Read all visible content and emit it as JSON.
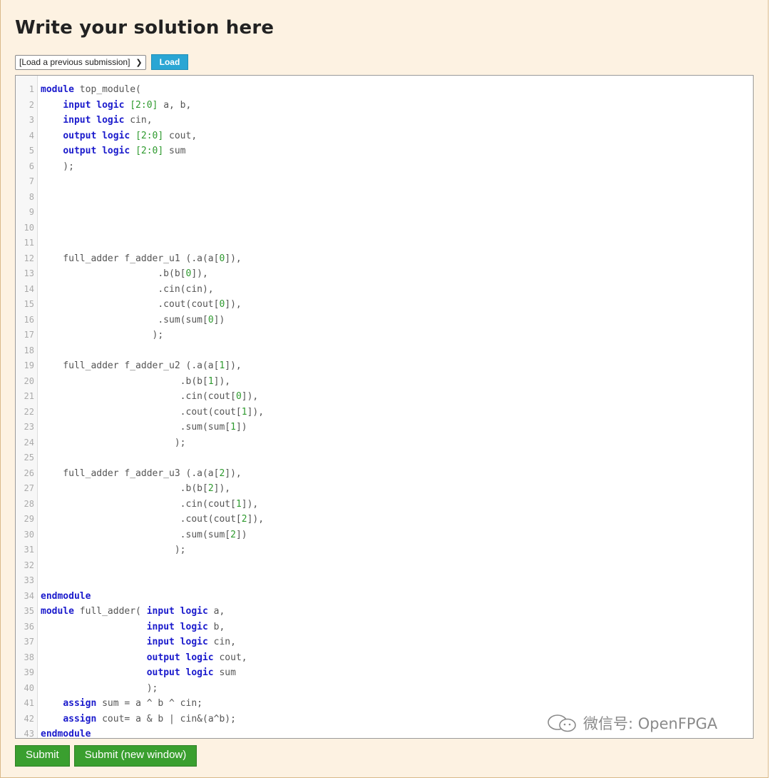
{
  "heading": "Write your solution here",
  "submission_select": {
    "selected": "[Load a previous submission]"
  },
  "load_button": "Load",
  "editor": {
    "lines": [
      [
        [
          "kw",
          "module"
        ],
        [
          "p",
          " top_module("
        ]
      ],
      [
        [
          "p",
          "    "
        ],
        [
          "kw",
          "input logic"
        ],
        [
          "p",
          " "
        ],
        [
          "num",
          "[2:0]"
        ],
        [
          "p",
          " a, b,"
        ]
      ],
      [
        [
          "p",
          "    "
        ],
        [
          "kw",
          "input logic"
        ],
        [
          "p",
          " cin,"
        ]
      ],
      [
        [
          "p",
          "    "
        ],
        [
          "kw",
          "output logic"
        ],
        [
          "p",
          " "
        ],
        [
          "num",
          "[2:0]"
        ],
        [
          "p",
          " cout,"
        ]
      ],
      [
        [
          "p",
          "    "
        ],
        [
          "kw",
          "output logic"
        ],
        [
          "p",
          " "
        ],
        [
          "num",
          "[2:0]"
        ],
        [
          "p",
          " sum"
        ]
      ],
      [
        [
          "p",
          "    );"
        ]
      ],
      [],
      [],
      [],
      [],
      [],
      [
        [
          "p",
          "    full_adder f_adder_u1 (.a(a["
        ],
        [
          "num",
          "0"
        ],
        [
          "p",
          "]),"
        ]
      ],
      [
        [
          "p",
          "                     .b(b["
        ],
        [
          "num",
          "0"
        ],
        [
          "p",
          "]),"
        ]
      ],
      [
        [
          "p",
          "                     .cin(cin),"
        ]
      ],
      [
        [
          "p",
          "                     .cout(cout["
        ],
        [
          "num",
          "0"
        ],
        [
          "p",
          "]),"
        ]
      ],
      [
        [
          "p",
          "                     .sum(sum["
        ],
        [
          "num",
          "0"
        ],
        [
          "p",
          "])"
        ]
      ],
      [
        [
          "p",
          "                    );"
        ]
      ],
      [],
      [
        [
          "p",
          "    full_adder f_adder_u2 (.a(a["
        ],
        [
          "num",
          "1"
        ],
        [
          "p",
          "]),"
        ]
      ],
      [
        [
          "p",
          "                         .b(b["
        ],
        [
          "num",
          "1"
        ],
        [
          "p",
          "]),"
        ]
      ],
      [
        [
          "p",
          "                         .cin(cout["
        ],
        [
          "num",
          "0"
        ],
        [
          "p",
          "]),"
        ]
      ],
      [
        [
          "p",
          "                         .cout(cout["
        ],
        [
          "num",
          "1"
        ],
        [
          "p",
          "]),"
        ]
      ],
      [
        [
          "p",
          "                         .sum(sum["
        ],
        [
          "num",
          "1"
        ],
        [
          "p",
          "])"
        ]
      ],
      [
        [
          "p",
          "                        );"
        ]
      ],
      [],
      [
        [
          "p",
          "    full_adder f_adder_u3 (.a(a["
        ],
        [
          "num",
          "2"
        ],
        [
          "p",
          "]),"
        ]
      ],
      [
        [
          "p",
          "                         .b(b["
        ],
        [
          "num",
          "2"
        ],
        [
          "p",
          "]),"
        ]
      ],
      [
        [
          "p",
          "                         .cin(cout["
        ],
        [
          "num",
          "1"
        ],
        [
          "p",
          "]),"
        ]
      ],
      [
        [
          "p",
          "                         .cout(cout["
        ],
        [
          "num",
          "2"
        ],
        [
          "p",
          "]),"
        ]
      ],
      [
        [
          "p",
          "                         .sum(sum["
        ],
        [
          "num",
          "2"
        ],
        [
          "p",
          "])"
        ]
      ],
      [
        [
          "p",
          "                        );"
        ]
      ],
      [],
      [],
      [
        [
          "kw",
          "endmodule"
        ]
      ],
      [
        [
          "kw",
          "module"
        ],
        [
          "p",
          " full_adder( "
        ],
        [
          "kw",
          "input logic"
        ],
        [
          "p",
          " a,"
        ]
      ],
      [
        [
          "p",
          "                   "
        ],
        [
          "kw",
          "input logic"
        ],
        [
          "p",
          " b,"
        ]
      ],
      [
        [
          "p",
          "                   "
        ],
        [
          "kw",
          "input logic"
        ],
        [
          "p",
          " cin,"
        ]
      ],
      [
        [
          "p",
          "                   "
        ],
        [
          "kw",
          "output logic"
        ],
        [
          "p",
          " cout,"
        ]
      ],
      [
        [
          "p",
          "                   "
        ],
        [
          "kw",
          "output logic"
        ],
        [
          "p",
          " sum"
        ]
      ],
      [
        [
          "p",
          "                   );"
        ]
      ],
      [
        [
          "p",
          "    "
        ],
        [
          "kw",
          "assign"
        ],
        [
          "p",
          " sum = a ^ b ^ cin;"
        ]
      ],
      [
        [
          "p",
          "    "
        ],
        [
          "kw",
          "assign"
        ],
        [
          "p",
          " cout= a & b | cin&(a^b);"
        ]
      ],
      [
        [
          "kw",
          "endmodule"
        ]
      ]
    ]
  },
  "watermark": "微信号: OpenFPGA",
  "buttons": {
    "submit": "Submit",
    "submit_new_window": "Submit (new window)"
  },
  "colors": {
    "keyword": "#1a1acc",
    "number": "#2e9a2e",
    "panel_bg": "#fdf2e2",
    "button_green": "#3a9f2f",
    "load_blue": "#2aa6d4"
  }
}
